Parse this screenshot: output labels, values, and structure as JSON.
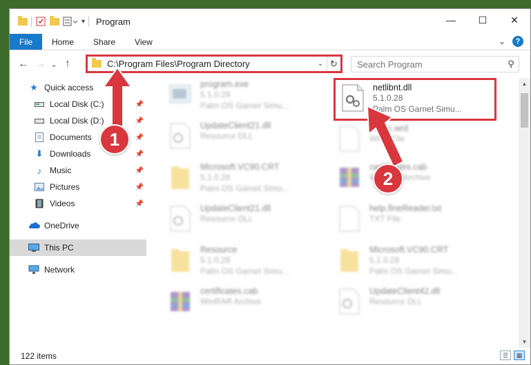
{
  "window": {
    "title": "Program",
    "controls": {
      "minimize": "—",
      "maximize": "☐",
      "close": "✕"
    }
  },
  "ribbon": {
    "tabs": [
      "File",
      "Home",
      "Share",
      "View"
    ],
    "chevron": "⌄",
    "help": "?"
  },
  "nav": {
    "back": "←",
    "forward": "→",
    "recent": "⌄",
    "up": "↑"
  },
  "address": {
    "path": "C:\\Program Files\\Program Directory",
    "dropdown": "⌄",
    "refresh": "↻"
  },
  "search": {
    "placeholder": "Search Program",
    "icon": "⚲"
  },
  "sidebar": {
    "quick_access": "Quick access",
    "items": [
      {
        "label": "Local Disk (C:)",
        "icon": "drive-icon"
      },
      {
        "label": "Local Disk (D:)",
        "icon": "drive-icon"
      },
      {
        "label": "Documents",
        "icon": "documents-icon"
      },
      {
        "label": "Downloads",
        "icon": "downloads-icon"
      },
      {
        "label": "Music",
        "icon": "music-icon"
      },
      {
        "label": "Pictures",
        "icon": "pictures-icon"
      },
      {
        "label": "Videos",
        "icon": "videos-icon"
      }
    ],
    "onedrive": "OneDrive",
    "this_pc": "This PC",
    "network": "Network",
    "pin": "📌"
  },
  "files": [
    {
      "name": "program.exe",
      "line2": "5.1.0.28",
      "line3": "Palm OS Garnet Simu...",
      "kind": "exe"
    },
    {
      "name": "netlibnt.dll",
      "line2": "5.1.0.28",
      "line3": "Palm OS Garnet Simu...",
      "kind": "dll"
    },
    {
      "name": "UpdateClient21.dll",
      "line2": "Resource DLL",
      "line3": "",
      "kind": "dll"
    },
    {
      "name": "Music.wrd",
      "line2": "WRD File",
      "line3": "",
      "kind": "blank"
    },
    {
      "name": "Microsoft.VC90.CRT",
      "line2": "5.1.0.28",
      "line3": "Palm OS Garnet Simu...",
      "kind": "folder"
    },
    {
      "name": "certificates.cab",
      "line2": "WinRAR Archive",
      "line3": "",
      "kind": "rar"
    },
    {
      "name": "UpdateClient21.dll",
      "line2": "Resource DLL",
      "line3": "",
      "kind": "dll"
    },
    {
      "name": "help.fineReader.txt",
      "line2": "TXT File",
      "line3": "",
      "kind": "blank"
    },
    {
      "name": "Resource",
      "line2": "5.1.0.28",
      "line3": "Palm OS Garnet Simu...",
      "kind": "folder"
    },
    {
      "name": "Microsoft.VC90.CRT",
      "line2": "5.1.0.28",
      "line3": "Palm OS Garnet Simu...",
      "kind": "folder"
    },
    {
      "name": "certificates.cab",
      "line2": "WinRAR Archive",
      "line3": "",
      "kind": "rar"
    },
    {
      "name": "UpdateClient42.dll",
      "line2": "Resource DLL",
      "line3": "",
      "kind": "dll"
    }
  ],
  "status": {
    "count": "122 items"
  },
  "annotations": {
    "step1": "1",
    "step2": "2"
  },
  "colors": {
    "accent": "#1979ca",
    "highlight": "#d9363e",
    "selected": "#d9d9d9"
  }
}
